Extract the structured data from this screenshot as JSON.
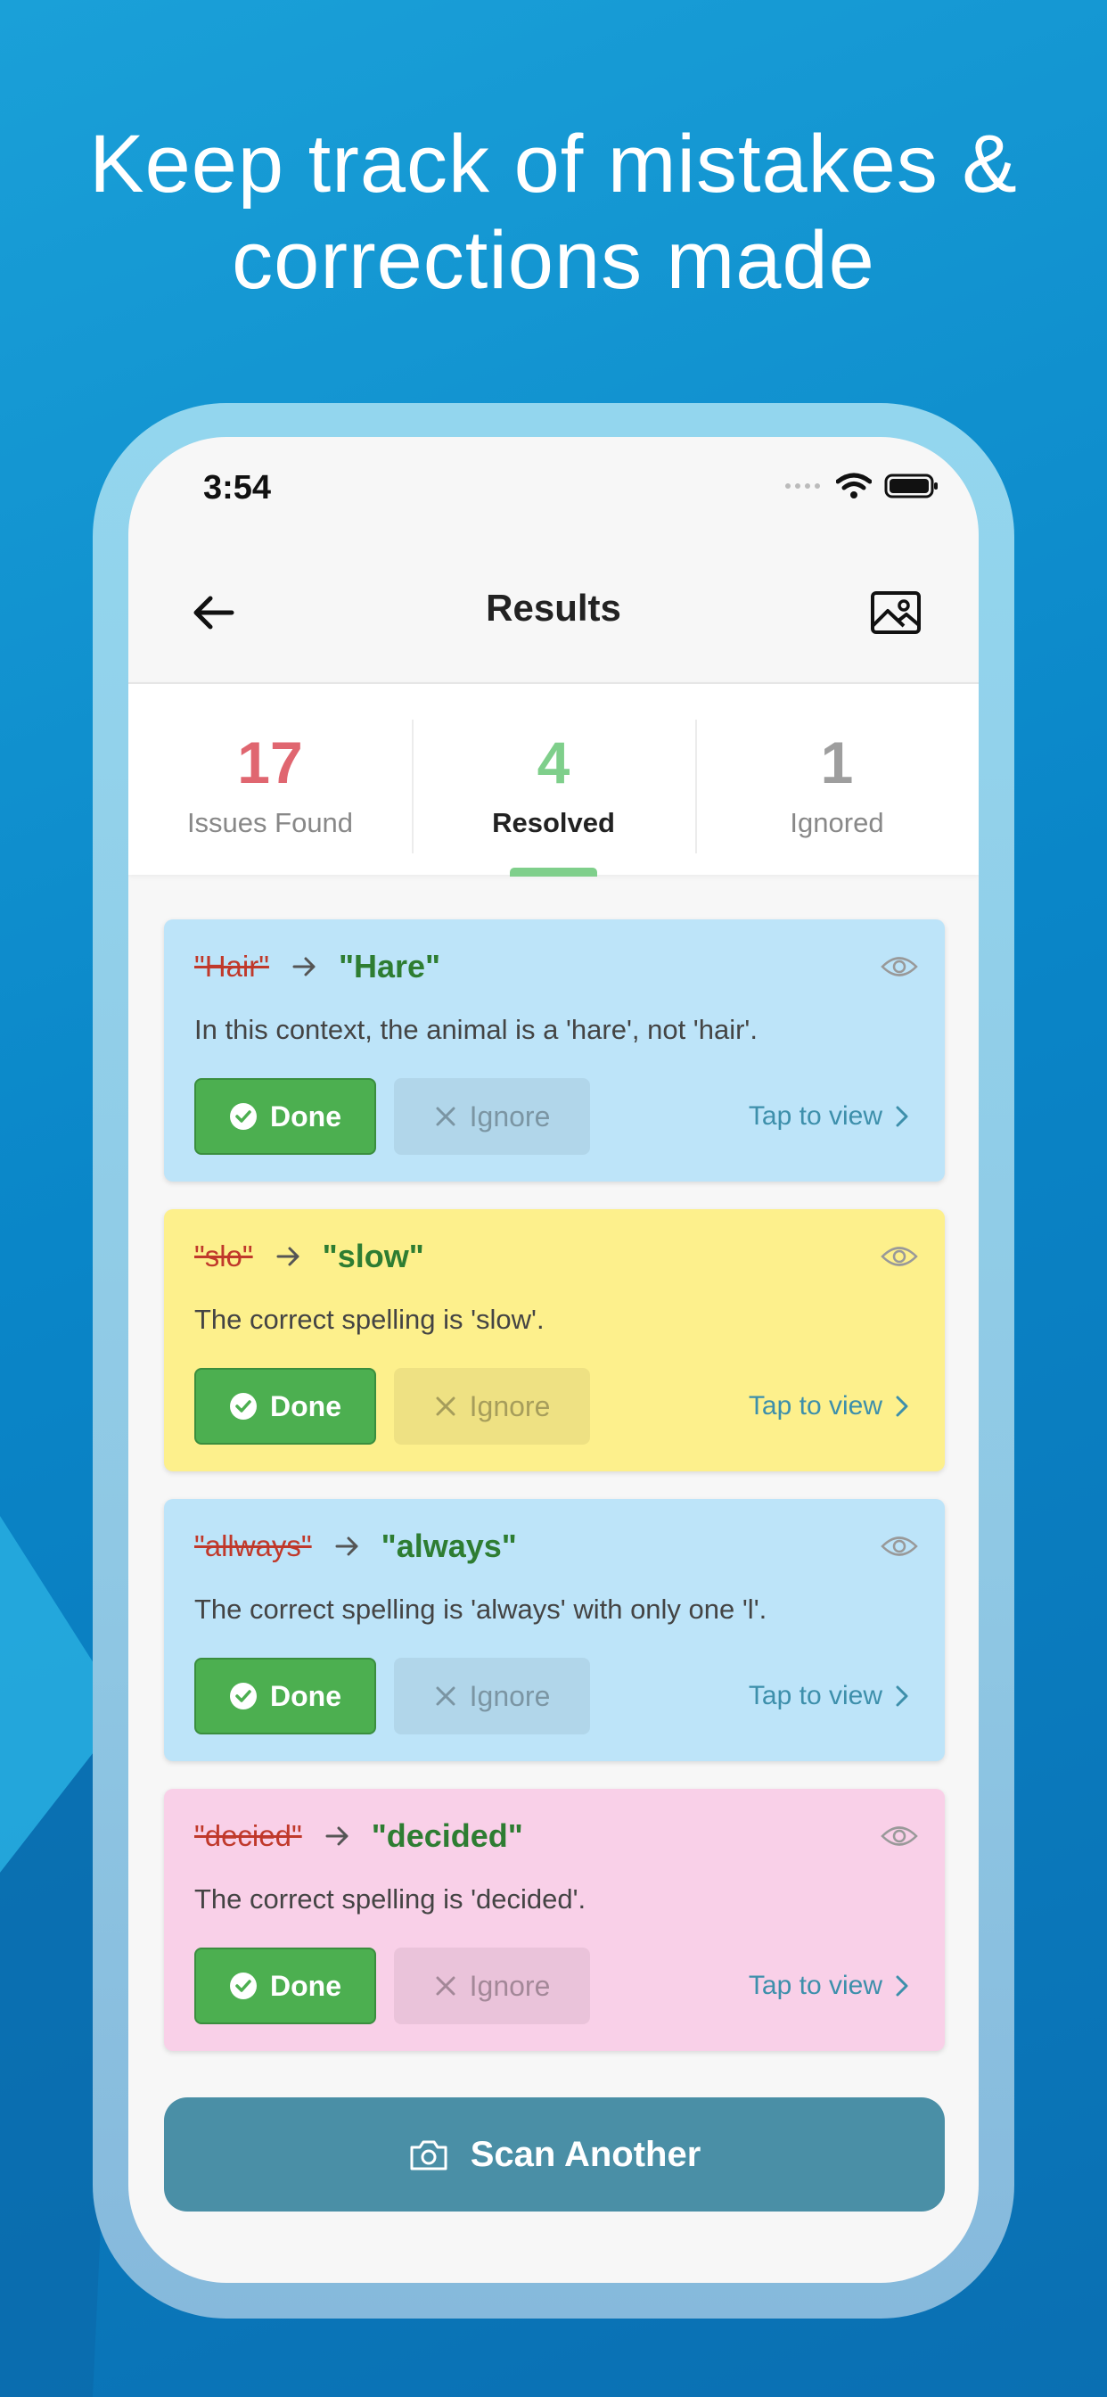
{
  "headline": [
    "Keep track of mistakes &",
    "corrections made"
  ],
  "status_bar": {
    "time": "3:54"
  },
  "nav": {
    "title": "Results"
  },
  "stats": [
    {
      "value": "17",
      "label": "Issues Found",
      "color": "#e06670"
    },
    {
      "value": "4",
      "label": "Resolved",
      "color": "#7fcf8b"
    },
    {
      "value": "1",
      "label": "Ignored",
      "color": "#9e9e9e"
    }
  ],
  "selected_tab": "Resolved",
  "cards": [
    {
      "wrong": "\"Hair\"",
      "right": "\"Hare\"",
      "description": "In this context, the animal is a 'hare', not 'hair'.",
      "color": "#bde4f9",
      "done": "Done",
      "ignore": "Ignore",
      "tap": "Tap to view"
    },
    {
      "wrong": "\"slo\"",
      "right": "\"slow\"",
      "description": "The correct spelling is 'slow'.",
      "color": "#fdf08c",
      "done": "Done",
      "ignore": "Ignore",
      "tap": "Tap to view"
    },
    {
      "wrong": "\"allways\"",
      "right": "\"always\"",
      "description": "The correct spelling is 'always' with only one 'l'.",
      "color": "#bde4f9",
      "done": "Done",
      "ignore": "Ignore",
      "tap": "Tap to view"
    },
    {
      "wrong": "\"decied\"",
      "right": "\"decided\"",
      "description": "The correct spelling is 'decided'.",
      "color": "#f9d0e8",
      "done": "Done",
      "ignore": "Ignore",
      "tap": "Tap to view"
    }
  ],
  "scan_button": {
    "label": "Scan Another",
    "color": "#4a8fa6"
  },
  "icons": [
    "back-arrow-icon",
    "image-icon",
    "eye-icon",
    "check-circle-icon",
    "x-icon",
    "chevron-right-icon",
    "camera-icon",
    "wifi-icon",
    "battery-icon",
    "signal-icon"
  ]
}
